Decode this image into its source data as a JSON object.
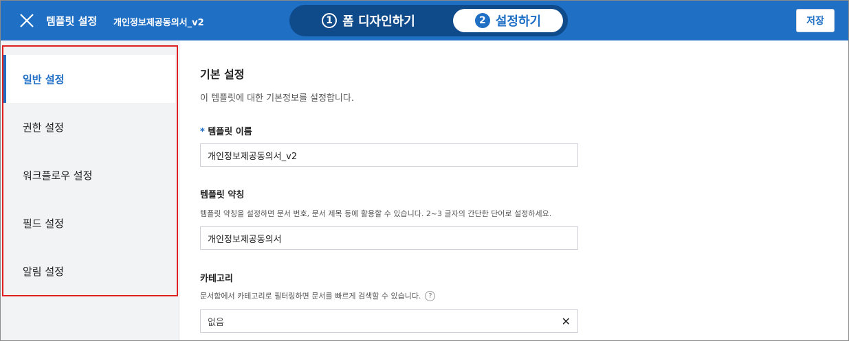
{
  "header": {
    "title": "템플릿 설정",
    "doc_name": "개인정보제공동의서_v2",
    "steps": [
      {
        "num": "1",
        "label": "폼 디자인하기"
      },
      {
        "num": "2",
        "label": "설정하기"
      }
    ],
    "save_label": "저장",
    "accent_color": "#1f6fc5"
  },
  "sidebar": {
    "items": [
      {
        "label": "일반 설정",
        "active": true
      },
      {
        "label": "권한 설정"
      },
      {
        "label": "워크플로우 설정"
      },
      {
        "label": "필드 설정"
      },
      {
        "label": "알림 설정"
      }
    ]
  },
  "main": {
    "title": "기본 설정",
    "description": "이 템플릿에 대한 기본정보를 설정합니다.",
    "name_field": {
      "required_mark": "*",
      "label": "템플릿 이름",
      "value": "개인정보제공동의서_v2"
    },
    "abbr_field": {
      "label": "템플릿 약칭",
      "hint": "템플릿 약칭을 설정하면 문서 번호, 문서 제목 등에 활용할 수 있습니다. 2~3 글자의 간단한 단어로 설정하세요.",
      "value": "개인정보제공동의서"
    },
    "category_field": {
      "label": "카테고리",
      "hint": "문서함에서 카테고리로 필터링하면 문서를 빠르게 검색할 수 있습니다.",
      "help": "?",
      "value": "없음",
      "clear": "✕"
    }
  }
}
